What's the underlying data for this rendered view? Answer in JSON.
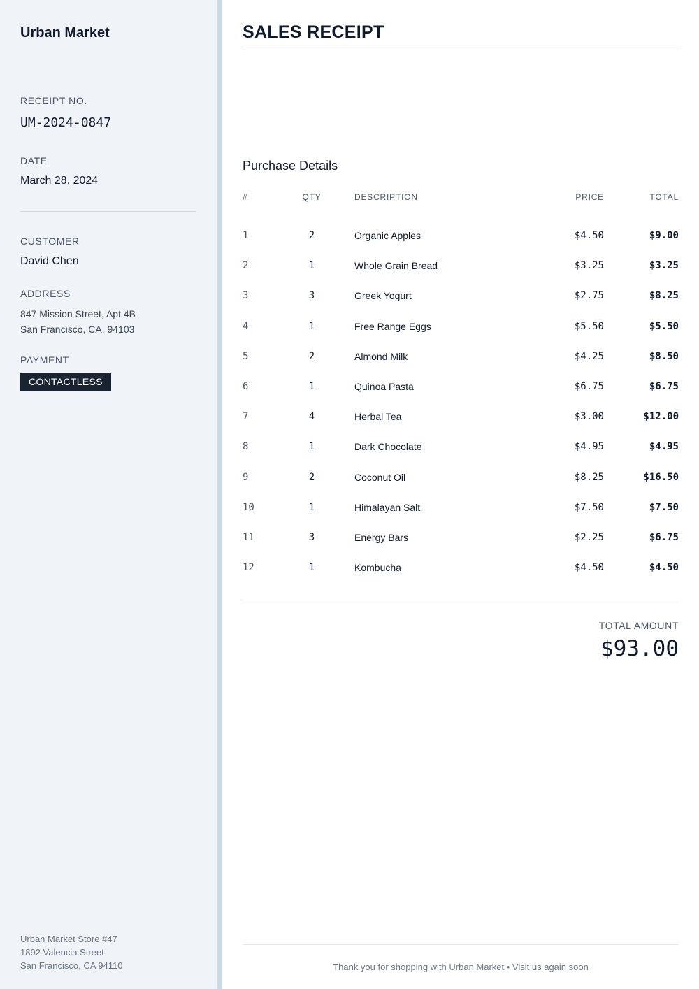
{
  "sidebar": {
    "brand": "Urban Market",
    "receipt_label": "RECEIPT NO.",
    "receipt_no": "UM-2024-0847",
    "date_label": "DATE",
    "date": "March 28, 2024",
    "customer_label": "CUSTOMER",
    "customer": "David Chen",
    "address_label": "ADDRESS",
    "address_line1": "847 Mission Street, Apt 4B",
    "address_line2": "San Francisco, CA, 94103",
    "payment_label": "PAYMENT",
    "payment": "CONTACTLESS",
    "store_line1": "Urban Market Store #47",
    "store_line2": "1892 Valencia Street",
    "store_line3": "San Francisco, CA 94110"
  },
  "main": {
    "title": "SALES RECEIPT",
    "section_title": "Purchase Details",
    "columns": {
      "num": "#",
      "qty": "QTY",
      "desc": "DESCRIPTION",
      "price": "PRICE",
      "total": "TOTAL"
    },
    "items": [
      {
        "num": "1",
        "qty": "2",
        "desc": "Organic Apples",
        "price": "$4.50",
        "total": "$9.00"
      },
      {
        "num": "2",
        "qty": "1",
        "desc": "Whole Grain Bread",
        "price": "$3.25",
        "total": "$3.25"
      },
      {
        "num": "3",
        "qty": "3",
        "desc": "Greek Yogurt",
        "price": "$2.75",
        "total": "$8.25"
      },
      {
        "num": "4",
        "qty": "1",
        "desc": "Free Range Eggs",
        "price": "$5.50",
        "total": "$5.50"
      },
      {
        "num": "5",
        "qty": "2",
        "desc": "Almond Milk",
        "price": "$4.25",
        "total": "$8.50"
      },
      {
        "num": "6",
        "qty": "1",
        "desc": "Quinoa Pasta",
        "price": "$6.75",
        "total": "$6.75"
      },
      {
        "num": "7",
        "qty": "4",
        "desc": "Herbal Tea",
        "price": "$3.00",
        "total": "$12.00"
      },
      {
        "num": "8",
        "qty": "1",
        "desc": "Dark Chocolate",
        "price": "$4.95",
        "total": "$4.95"
      },
      {
        "num": "9",
        "qty": "2",
        "desc": "Coconut Oil",
        "price": "$8.25",
        "total": "$16.50"
      },
      {
        "num": "10",
        "qty": "1",
        "desc": "Himalayan Salt",
        "price": "$7.50",
        "total": "$7.50"
      },
      {
        "num": "11",
        "qty": "3",
        "desc": "Energy Bars",
        "price": "$2.25",
        "total": "$6.75"
      },
      {
        "num": "12",
        "qty": "1",
        "desc": "Kombucha",
        "price": "$4.50",
        "total": "$4.50"
      }
    ],
    "total_label": "TOTAL AMOUNT",
    "total_amount": "$93.00",
    "footer": "Thank you for shopping with Urban Market • Visit us again soon"
  }
}
